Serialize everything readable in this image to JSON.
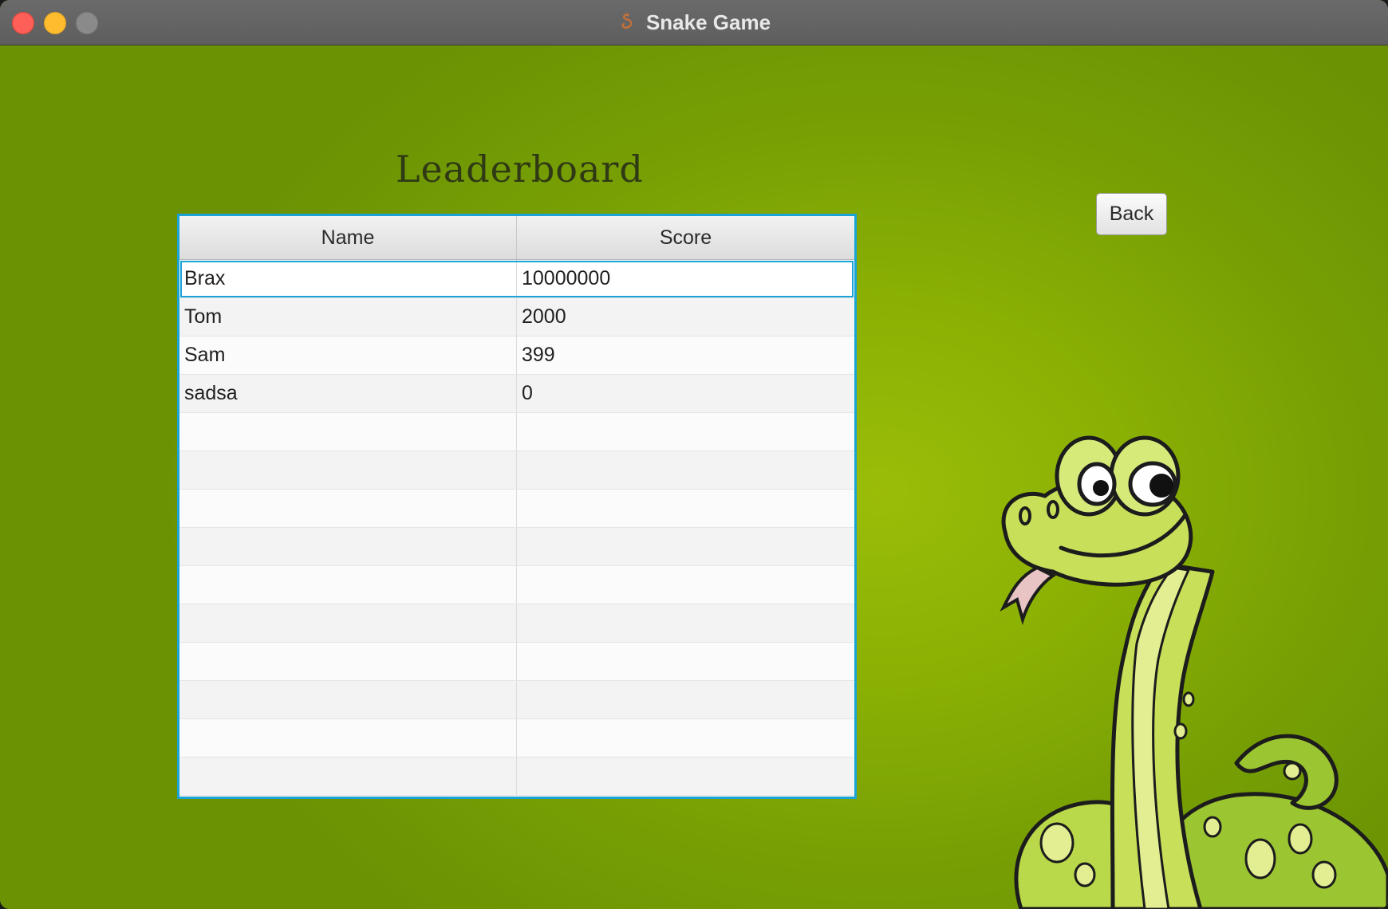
{
  "window": {
    "title": "Snake Game",
    "app_icon": "snake-app-icon"
  },
  "heading": "Leaderboard",
  "table": {
    "columns": [
      "Name",
      "Score"
    ],
    "rows": [
      {
        "name": "Brax",
        "score": "10000000"
      },
      {
        "name": "Tom",
        "score": "2000"
      },
      {
        "name": "Sam",
        "score": "399"
      },
      {
        "name": "sadsa",
        "score": "0"
      }
    ],
    "selected_row": 0
  },
  "back_label": "Back",
  "colors": {
    "background": "#8ab004",
    "table_focus_border": "#1aa3d6",
    "heading": "#2f3a14"
  }
}
